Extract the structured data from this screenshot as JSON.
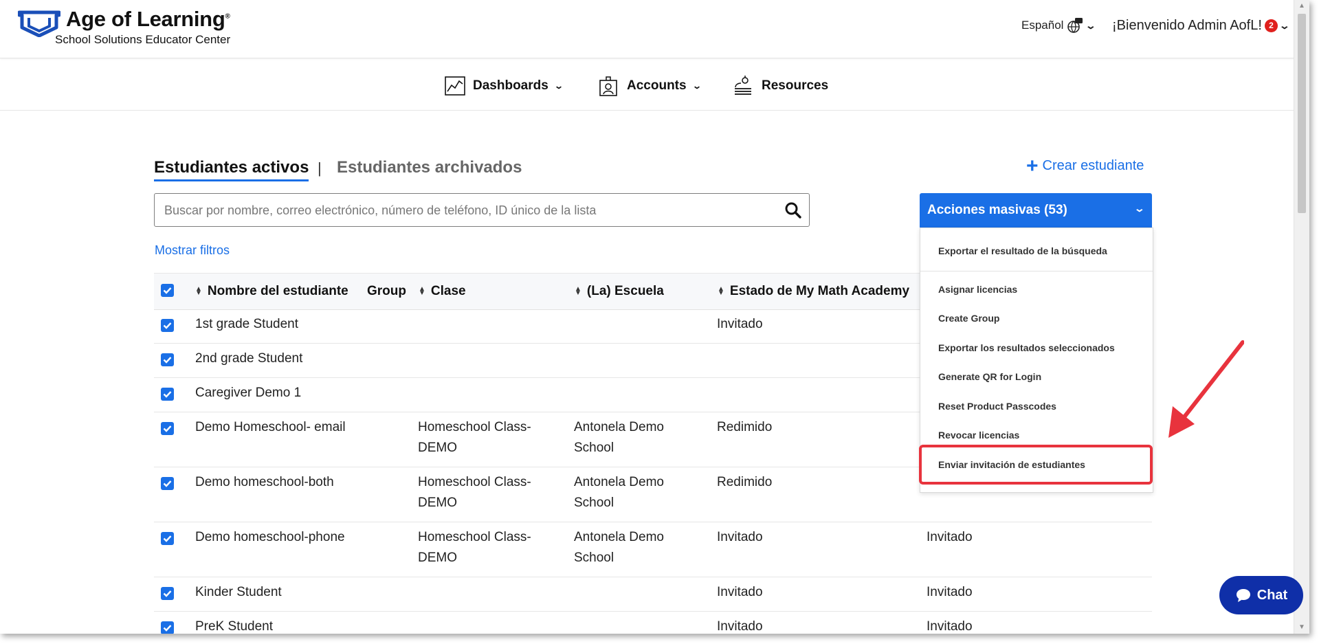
{
  "header": {
    "logo_title": "Age of Learning",
    "logo_reg": "®",
    "logo_subtitle": "School Solutions Educator Center",
    "language": "Español",
    "welcome": "¡Bienvenido Admin AofL!",
    "notification_count": "2"
  },
  "nav": {
    "items": [
      {
        "label": "Dashboards",
        "icon": "chart-icon"
      },
      {
        "label": "Accounts",
        "icon": "accounts-icon"
      },
      {
        "label": "Resources",
        "icon": "books-icon"
      }
    ]
  },
  "tabs": {
    "active": "Estudiantes activos",
    "separator": "|",
    "archived": "Estudiantes archivados"
  },
  "create_button": "Crear estudiante",
  "search": {
    "placeholder": "Buscar por nombre, correo electrónico, número de teléfono, ID único de la lista"
  },
  "show_filters": "Mostrar filtros",
  "bulk_actions": {
    "label": "Acciones masivas (53)",
    "items": [
      "Exportar el resultado de la búsqueda",
      "Asignar licencias",
      "Create Group",
      "Exportar los resultados seleccionados",
      "Generate QR for Login",
      "Reset Product Passcodes",
      "Revocar licencias",
      "Enviar invitación de estudiantes"
    ]
  },
  "table": {
    "columns": [
      "Nombre del estudiante",
      "Group",
      "Clase",
      "(La) Escuela",
      "Estado de My Math Academy"
    ],
    "rows": [
      {
        "name": "1st grade Student",
        "clase": [
          "",
          ""
        ],
        "escuela": [
          "",
          ""
        ],
        "estado": "Invitado",
        "estado2": ""
      },
      {
        "name": "2nd grade Student",
        "clase": [
          "",
          ""
        ],
        "escuela": [
          "",
          ""
        ],
        "estado": "",
        "estado2": ""
      },
      {
        "name": "Caregiver Demo 1",
        "clase": [
          "",
          ""
        ],
        "escuela": [
          "",
          ""
        ],
        "estado": "",
        "estado2": ""
      },
      {
        "name": "Demo Homeschool- email",
        "clase": [
          "Homeschool Class-",
          "DEMO"
        ],
        "escuela": [
          "Antonela Demo",
          "School"
        ],
        "estado": "Redimido",
        "estado2": ""
      },
      {
        "name": "Demo homeschool-both",
        "clase": [
          "Homeschool Class-",
          "DEMO"
        ],
        "escuela": [
          "Antonela Demo",
          "School"
        ],
        "estado": "Redimido",
        "estado2": ""
      },
      {
        "name": "Demo homeschool-phone",
        "clase": [
          "Homeschool Class-",
          "DEMO"
        ],
        "escuela": [
          "Antonela Demo",
          "School"
        ],
        "estado": "Invitado",
        "estado2": "Invitado"
      },
      {
        "name": "Kinder Student",
        "clase": [
          "",
          ""
        ],
        "escuela": [
          "",
          ""
        ],
        "estado": "Invitado",
        "estado2": "Invitado"
      },
      {
        "name": "PreK Student",
        "clase": [
          "",
          ""
        ],
        "escuela": [
          "",
          ""
        ],
        "estado": "Invitado",
        "estado2": "Invitado"
      }
    ]
  },
  "chat_label": "Chat",
  "colors": {
    "accent": "#1a6fe6",
    "highlight": "#e8333d",
    "chat": "#0f2fa8",
    "badge": "#e0201d"
  }
}
